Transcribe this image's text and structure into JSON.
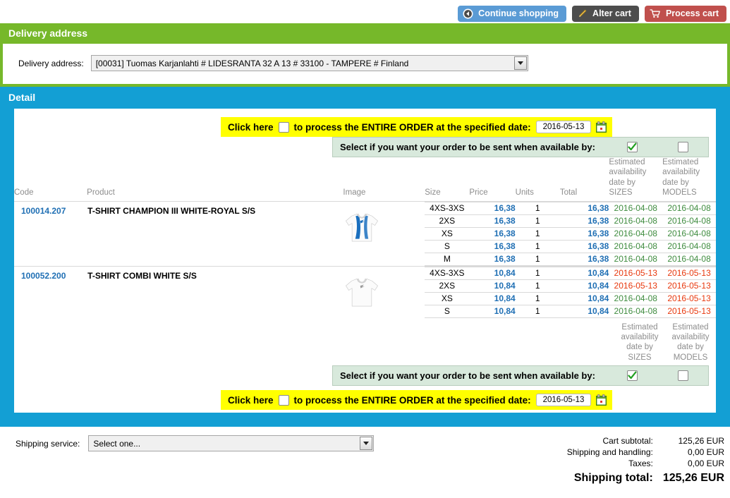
{
  "toolbar": {
    "continue_shopping": "Continue shopping",
    "alter_cart": "Alter cart",
    "process_cart": "Process cart"
  },
  "delivery": {
    "panel_title": "Delivery address",
    "field_label": "Delivery address:",
    "selected": "[00031] Tuomas Karjanlahti # LIDESRANTA 32 A 13 # 33100 - TAMPERE # Finland"
  },
  "detail": {
    "panel_title": "Detail",
    "entire_order_prefix": "Click here",
    "entire_order_suffix": "to process the ENTIRE ORDER at the specified date:",
    "entire_order_date_top": "2016-05-13",
    "entire_order_date_bottom": "2016-05-13",
    "entire_order_checked_top": false,
    "entire_order_checked_bottom": false,
    "availability_strip_label": "Select if you want your order to be sent when available by:",
    "availability_sizes_checked": true,
    "availability_models_checked": false,
    "columns": {
      "code": "Code",
      "product": "Product",
      "image": "Image",
      "size": "Size",
      "price": "Price",
      "units": "Units",
      "total": "Total",
      "avail_sizes": "Estimated availability date by SIZES",
      "avail_sizes_lines": [
        "Estimated",
        "availability",
        "date by",
        "SIZES"
      ],
      "avail_models": "Estimated availability date by MODELS",
      "avail_models_lines": [
        "Estimated",
        "availability",
        "date by",
        "MODELS"
      ]
    },
    "products": [
      {
        "code": "100014.207",
        "name": "T-SHIRT CHAMPION III WHITE-ROYAL S/S",
        "image": "white-blue-tshirt",
        "variants": [
          {
            "size": "4XS-3XS",
            "price": "16,38",
            "units": "1",
            "total": "16,38",
            "avail_sizes": "2016-04-08",
            "avail_sizes_status": "ok",
            "avail_models": "2016-04-08",
            "avail_models_status": "ok"
          },
          {
            "size": "2XS",
            "price": "16,38",
            "units": "1",
            "total": "16,38",
            "avail_sizes": "2016-04-08",
            "avail_sizes_status": "ok",
            "avail_models": "2016-04-08",
            "avail_models_status": "ok"
          },
          {
            "size": "XS",
            "price": "16,38",
            "units": "1",
            "total": "16,38",
            "avail_sizes": "2016-04-08",
            "avail_sizes_status": "ok",
            "avail_models": "2016-04-08",
            "avail_models_status": "ok"
          },
          {
            "size": "S",
            "price": "16,38",
            "units": "1",
            "total": "16,38",
            "avail_sizes": "2016-04-08",
            "avail_sizes_status": "ok",
            "avail_models": "2016-04-08",
            "avail_models_status": "ok"
          },
          {
            "size": "M",
            "price": "16,38",
            "units": "1",
            "total": "16,38",
            "avail_sizes": "2016-04-08",
            "avail_sizes_status": "ok",
            "avail_models": "2016-04-08",
            "avail_models_status": "ok"
          }
        ]
      },
      {
        "code": "100052.200",
        "name": "T-SHIRT COMBI WHITE S/S",
        "image": "white-tshirt",
        "variants": [
          {
            "size": "4XS-3XS",
            "price": "10,84",
            "units": "1",
            "total": "10,84",
            "avail_sizes": "2016-05-13",
            "avail_sizes_status": "late",
            "avail_models": "2016-05-13",
            "avail_models_status": "late"
          },
          {
            "size": "2XS",
            "price": "10,84",
            "units": "1",
            "total": "10,84",
            "avail_sizes": "2016-05-13",
            "avail_sizes_status": "late",
            "avail_models": "2016-05-13",
            "avail_models_status": "late"
          },
          {
            "size": "XS",
            "price": "10,84",
            "units": "1",
            "total": "10,84",
            "avail_sizes": "2016-04-08",
            "avail_sizes_status": "ok",
            "avail_models": "2016-05-13",
            "avail_models_status": "late"
          },
          {
            "size": "S",
            "price": "10,84",
            "units": "1",
            "total": "10,84",
            "avail_sizes": "2016-04-08",
            "avail_sizes_status": "ok",
            "avail_models": "2016-05-13",
            "avail_models_status": "late"
          }
        ]
      }
    ]
  },
  "footer": {
    "shipping_service_label": "Shipping service:",
    "shipping_service_value": "Select one...",
    "totals": [
      {
        "label": "Cart subtotal:",
        "value": "125,26 EUR"
      },
      {
        "label": "Shipping and handling:",
        "value": "0,00 EUR"
      },
      {
        "label": "Taxes:",
        "value": "0,00 EUR"
      }
    ],
    "grand_label": "Shipping total:",
    "grand_value": "125,26 EUR"
  },
  "colors": {
    "green": "#76b82a",
    "blue": "#139fd4",
    "yellow": "#ffff00",
    "link_blue": "#1f6fb4",
    "date_ok": "#3f8c3f",
    "date_late": "#e8380d",
    "btn_continue": "#5a9bd5",
    "btn_alter": "#4d4d4d",
    "btn_process": "#c0504d"
  }
}
